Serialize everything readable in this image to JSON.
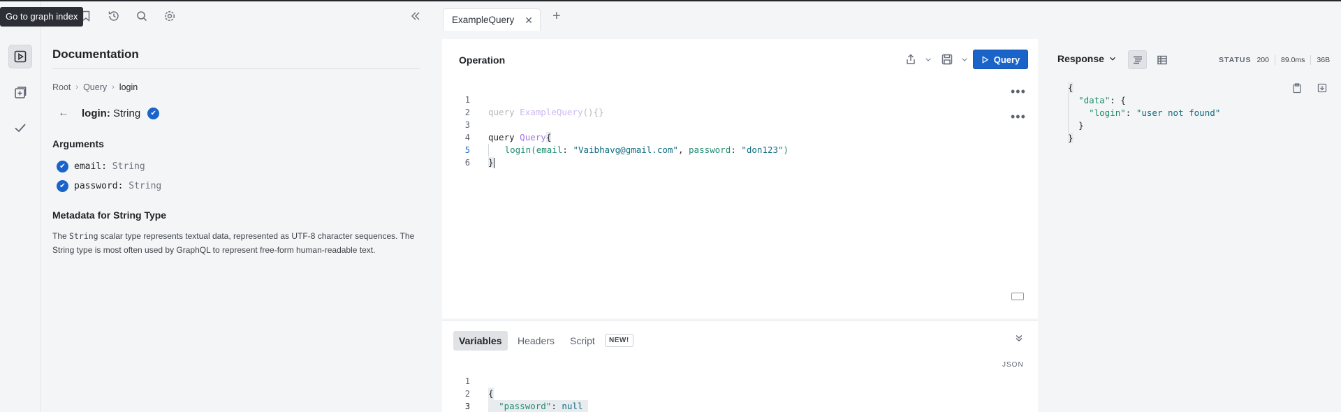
{
  "tooltip": "Go to graph index",
  "docs": {
    "title": "Documentation",
    "breadcrumb": [
      "Root",
      "Query",
      "login"
    ],
    "field_name": "login",
    "field_type": "String",
    "arguments_title": "Arguments",
    "arguments": [
      {
        "name": "email",
        "type": "String"
      },
      {
        "name": "password",
        "type": "String"
      }
    ],
    "metadata_title": "Metadata for String Type",
    "desc_pre": "The ",
    "desc_code": "String",
    "desc_post": " scalar type represents textual data, represented as UTF-8 character sequences. The String type is most often used by GraphQL to represent free-form human-readable text."
  },
  "tabs": [
    {
      "label": "ExampleQuery"
    }
  ],
  "operation": {
    "title": "Operation",
    "run_label": "Query",
    "line_numbers": [
      "1",
      "2",
      "3",
      "4",
      "5",
      "6"
    ],
    "line1_kw": "query",
    "line1_name": "ExampleQuery",
    "line1_rest": "(){}",
    "line3_kw": "query",
    "line3_name": "Query",
    "line3_brace": "{",
    "line4_call": "login(",
    "line4_arg1": "email",
    "line4_sep1": ": ",
    "line4_val1": "\"Vaibhavg@gmail.com\"",
    "line4_comma": ", ",
    "line4_arg2": "password",
    "line4_sep2": ": ",
    "line4_val2": "\"don123\"",
    "line4_close": ")",
    "line5": "}",
    "more_menu": "•••"
  },
  "variables": {
    "tabs": [
      "Variables",
      "Headers",
      "Script"
    ],
    "new_badge": "NEW!",
    "json_label": "JSON",
    "line_numbers": [
      "1",
      "2",
      "3"
    ],
    "open": "{",
    "key": "\"password\"",
    "colon": ": ",
    "value": "null",
    "close": "}"
  },
  "response": {
    "title": "Response",
    "status_label": "STATUS",
    "status_code": "200",
    "time": "89.0ms",
    "size": "36B",
    "open": "{",
    "data_key": "\"data\"",
    "data_open": ": {",
    "login_key": "\"login\"",
    "login_colon": ": ",
    "login_val": "\"user not found\"",
    "data_close": "}",
    "close": "}"
  },
  "colors": {
    "accent": "#1a64c9"
  }
}
